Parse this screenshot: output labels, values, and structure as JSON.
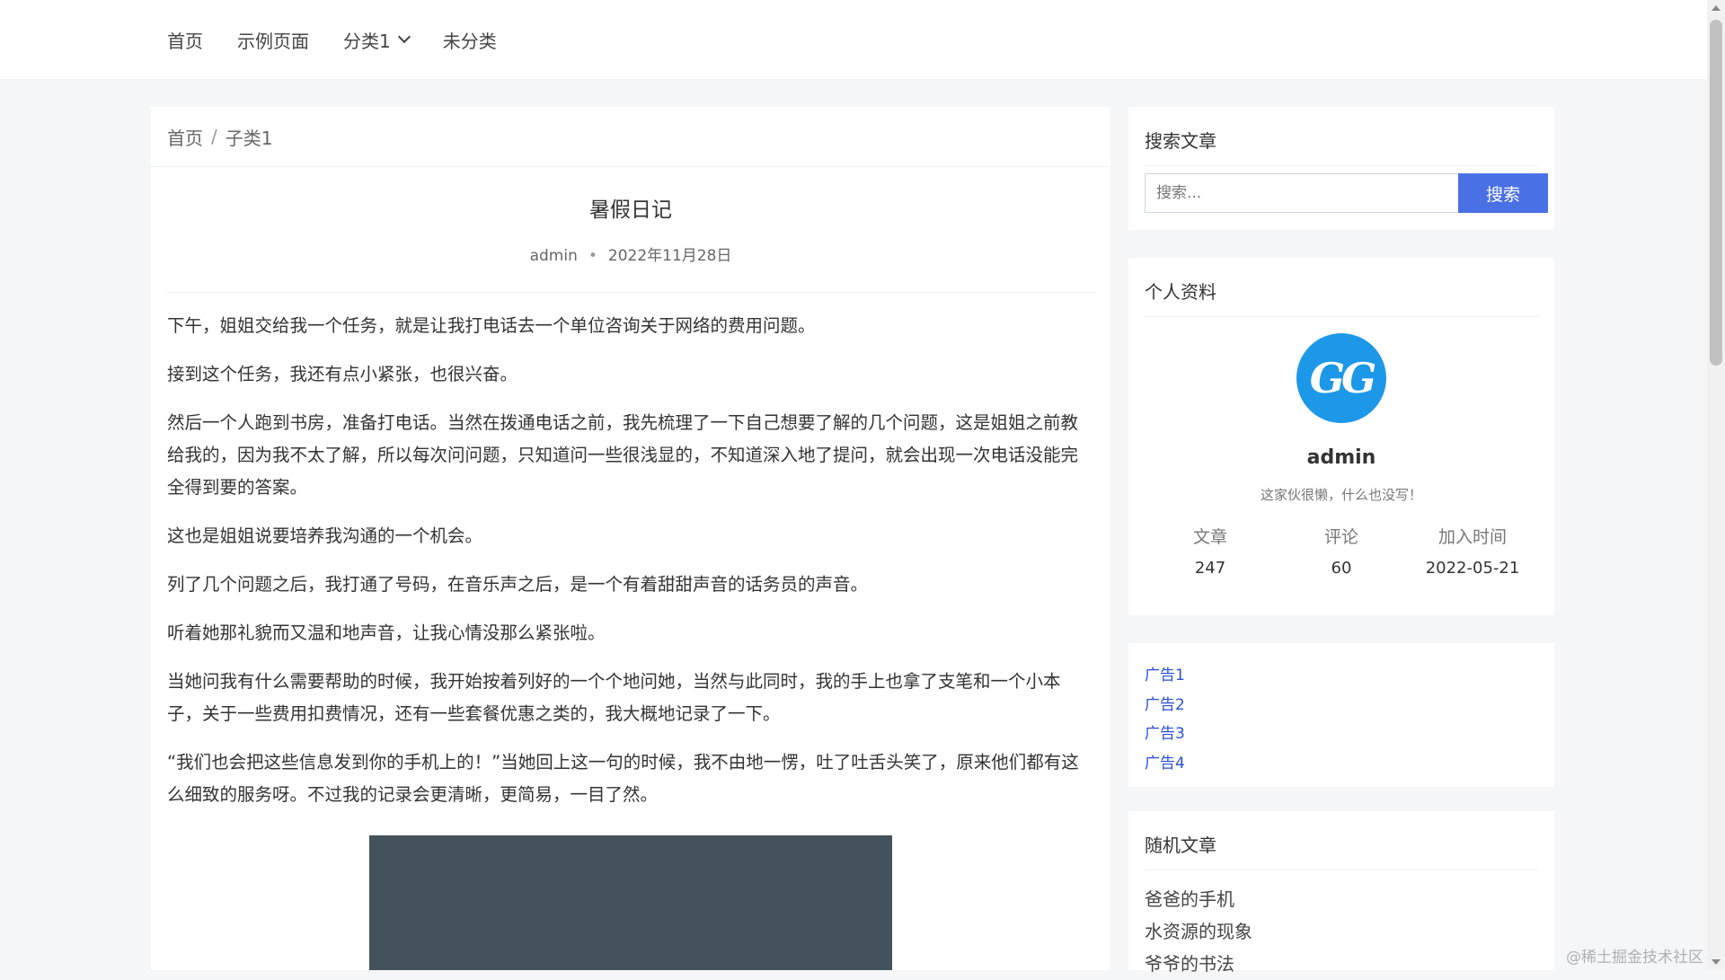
{
  "topnav": {
    "items": [
      {
        "label": "首页"
      },
      {
        "label": "示例页面"
      },
      {
        "label": "分类1"
      },
      {
        "label": "未分类"
      }
    ]
  },
  "breadcrumb": {
    "home": "首页",
    "separator": "/",
    "current": "子类1"
  },
  "article": {
    "title": "暑假日记",
    "author": "admin",
    "date": "2022年11月28日",
    "paragraphs": [
      "下午，姐姐交给我一个任务，就是让我打电话去一个单位咨询关于网络的费用问题。",
      "接到这个任务，我还有点小紧张，也很兴奋。",
      "然后一个人跑到书房，准备打电话。当然在拨通电话之前，我先梳理了一下自己想要了解的几个问题，这是姐姐之前教给我的，因为我不太了解，所以每次问问题，只知道问一些很浅显的，不知道深入地了提问，就会出现一次电话没能完全得到要的答案。",
      "这也是姐姐说要培养我沟通的一个机会。",
      "列了几个问题之后，我打通了号码，在音乐声之后，是一个有着甜甜声音的话务员的声音。",
      "听着她那礼貌而又温和地声音，让我心情没那么紧张啦。",
      "当她问我有什么需要帮助的时候，我开始按着列好的一个个地问她，当然与此同时，我的手上也拿了支笔和一个小本子，关于一些费用扣费情况，还有一些套餐优惠之类的，我大概地记录了一下。",
      "“我们也会把这些信息发到你的手机上的！”当她回上这一句的时候，我不由地一愣，吐了吐舌头笑了，原来他们都有这么细致的服务呀。不过我的记录会更清晰，更简易，一目了然。"
    ]
  },
  "search": {
    "title": "搜索文章",
    "placeholder": "搜索...",
    "button": "搜索"
  },
  "profile": {
    "title": "个人资料",
    "avatar_text": "GG",
    "name": "admin",
    "bio": "这家伙很懒，什么也没写！",
    "stats": [
      {
        "label": "文章",
        "value": "247"
      },
      {
        "label": "评论",
        "value": "60"
      },
      {
        "label": "加入时间",
        "value": "2022-05-21"
      }
    ]
  },
  "ads": [
    "广告1",
    "广告2",
    "广告3",
    "广告4"
  ],
  "random": {
    "title": "随机文章",
    "items": [
      "爸爸的手机",
      "水资源的现象",
      "爷爷的书法"
    ]
  },
  "watermark": "@稀土掘金技术社区",
  "colors": {
    "accent": "#4a70e6",
    "link": "#2b4fd9",
    "image_placeholder": "#44525c",
    "avatar": "#1d98e8"
  }
}
